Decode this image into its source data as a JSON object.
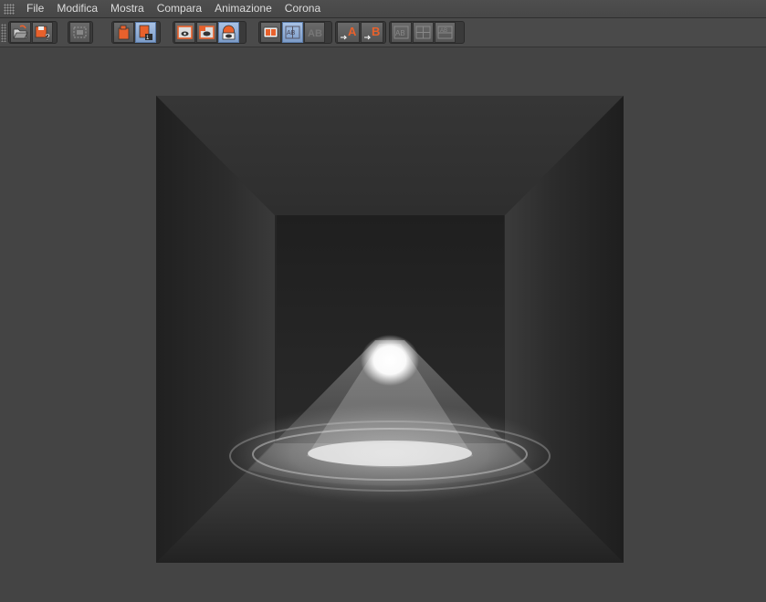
{
  "menu": {
    "items": [
      {
        "label": "File"
      },
      {
        "label": "Modifica"
      },
      {
        "label": "Mostra"
      },
      {
        "label": "Compara"
      },
      {
        "label": "Animazione"
      },
      {
        "label": "Corona"
      }
    ]
  },
  "toolbar": {
    "compare_a_label": "A",
    "compare_b_label": "B",
    "accent_color": "#e8612c",
    "active_color": "#8eaee0"
  },
  "icons": [
    "open-file-icon",
    "save-as-icon",
    "render-region-icon",
    "render-icon",
    "render-to-picture-viewer-icon",
    "view-frame-icon",
    "view-frame-alt-icon",
    "eye-icon",
    "ab-compare-icon",
    "ab-split-icon",
    "ab-text-icon",
    "set-a-icon",
    "set-b-icon",
    "ab-swap-icon",
    "ab-vertical-icon",
    "ab-horizontal-icon"
  ]
}
